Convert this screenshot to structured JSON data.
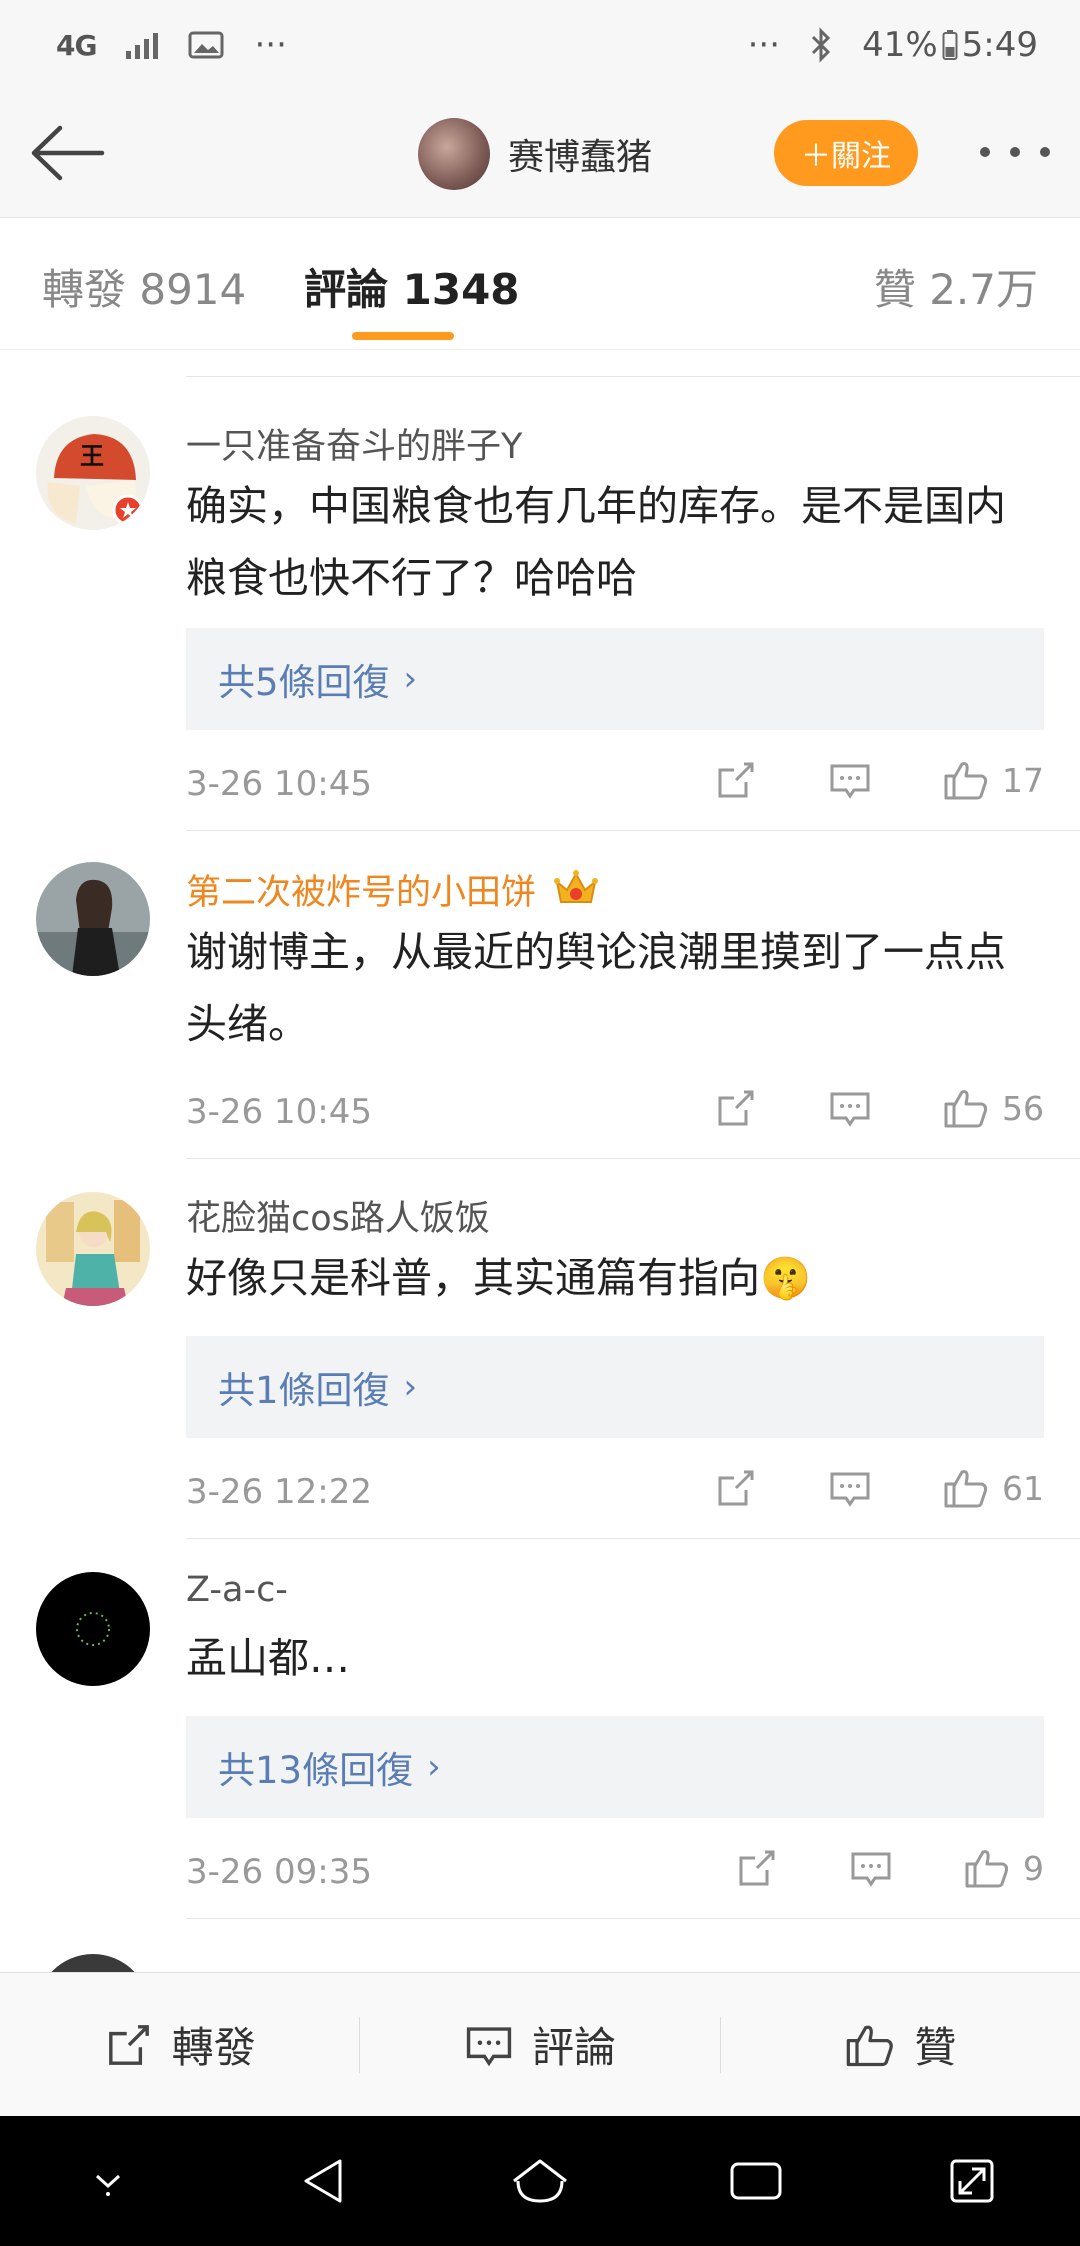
{
  "status_bar": {
    "network": "4G",
    "more_left": "···",
    "more_right": "···",
    "battery": "41%",
    "time": "5:49"
  },
  "header": {
    "user_name": "赛博蠢猪",
    "follow_label": "＋關注"
  },
  "tabs": {
    "repost_label": "轉發 8914",
    "comment_label": "評論 1348",
    "like_label": "贊 2.7万"
  },
  "comments": [
    {
      "user": "一只准备奋斗的胖子Y",
      "text": "确实，中国粮食也有几年的库存。是不是国内粮食也快不行了？哈哈哈",
      "replies": "共5條回復",
      "time": "3-26 10:45",
      "likes": "17"
    },
    {
      "user": "第二次被炸号的小田饼",
      "text": "谢谢博主，从最近的舆论浪潮里摸到了一点点头绪。",
      "time": "3-26 10:45",
      "likes": "56"
    },
    {
      "user": "花脸猫cos路人饭饭",
      "text": "好像只是科普，其实通篇有指向🤫",
      "replies": "共1條回復",
      "time": "3-26 12:22",
      "likes": "61"
    },
    {
      "user": "Z-a-c-",
      "text": "孟山都…",
      "replies": "共13條回復",
      "time": "3-26 09:35",
      "likes": "9"
    }
  ],
  "bottom_bar": {
    "repost": "轉發",
    "comment": "評論",
    "like": "贊"
  },
  "colors": {
    "accent": "#ff9a1f",
    "reply_link": "#5a7eb4",
    "vip_name": "#f0861f"
  }
}
